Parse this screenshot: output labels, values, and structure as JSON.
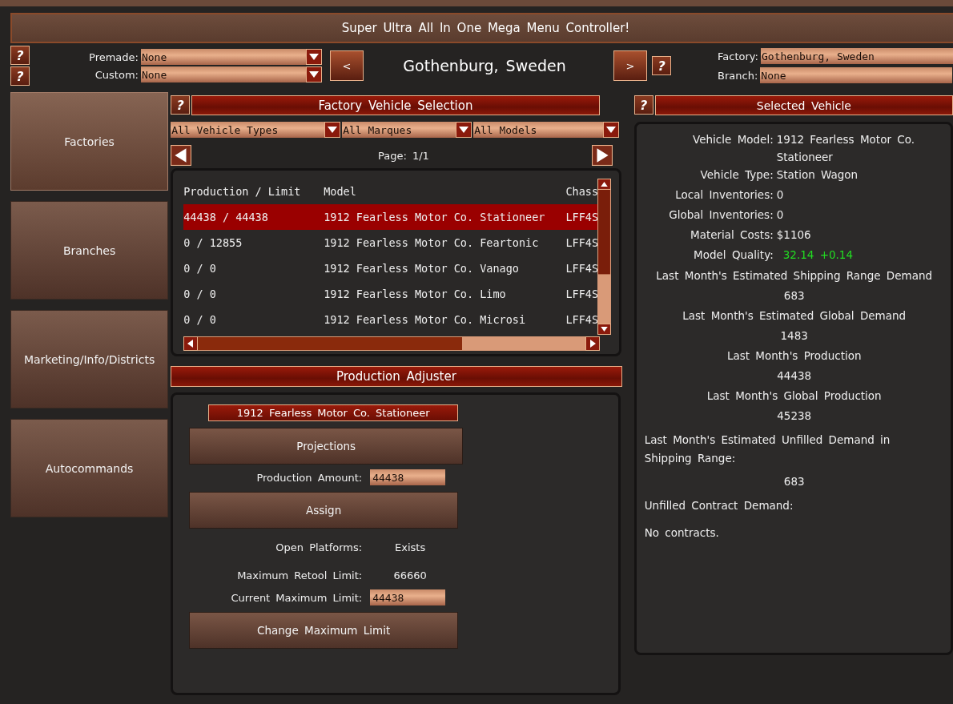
{
  "window": {
    "title": "Super Ultra All In One Mega Menu Controller!"
  },
  "top": {
    "left_help": [
      "?",
      "?"
    ],
    "selectors": [
      {
        "label": "Premade:",
        "value": "None"
      },
      {
        "label": "Custom:",
        "value": "None"
      }
    ],
    "prev_button": "<",
    "city": "Gothenburg, Sweden",
    "next_button": ">",
    "right_help": "?",
    "fields": [
      {
        "label": "Factory:",
        "value": "Gothenburg, Sweden"
      },
      {
        "label": "Branch:",
        "value": "None"
      }
    ]
  },
  "sidebar": {
    "items": [
      {
        "label": "Factories",
        "selected": true
      },
      {
        "label": "Branches",
        "selected": false
      },
      {
        "label": "Marketing/Info/Districts",
        "selected": false
      },
      {
        "label": "Autocommands",
        "selected": false
      }
    ]
  },
  "vehicle_selection": {
    "help": "?",
    "title": "Factory Vehicle Selection",
    "filters": [
      "All Vehicle Types",
      "All Marques",
      "All Models"
    ],
    "page": "Page: 1/1",
    "table": {
      "columns": [
        "Production / Limit",
        "Model",
        "Chass"
      ],
      "rows": [
        {
          "cells": [
            "44438 / 44438",
            "1912 Fearless Motor Co. Stationeer",
            "LFF4S"
          ],
          "selected": true
        },
        {
          "cells": [
            "0 / 12855",
            "1912 Fearless Motor Co. Feartonic",
            "LFF4S"
          ],
          "selected": false
        },
        {
          "cells": [
            "0 / 0",
            "1912 Fearless Motor Co. Vanago",
            "LFF4S"
          ],
          "selected": false
        },
        {
          "cells": [
            "0 / 0",
            "1912 Fearless Motor Co. Limo",
            "LFF4S"
          ],
          "selected": false
        },
        {
          "cells": [
            "0 / 0",
            "1912 Fearless Motor Co. Microsi",
            "LFF4S"
          ],
          "selected": false
        }
      ]
    }
  },
  "production_adjuster": {
    "title": "Production Adjuster",
    "model": "1912 Fearless Motor Co. Stationeer",
    "items": [
      {
        "kind": "button",
        "label": "Projections"
      },
      {
        "kind": "field",
        "label": "Production Amount:",
        "value": "44438"
      },
      {
        "kind": "button",
        "label": "Assign"
      },
      {
        "kind": "info",
        "label": "Open Platforms:",
        "value": "Exists"
      },
      {
        "kind": "info",
        "label": "Maximum Retool Limit:",
        "value": "66660"
      },
      {
        "kind": "field",
        "label": "Current Maximum Limit:",
        "value": "44438"
      },
      {
        "kind": "button",
        "label": "Change Maximum Limit"
      }
    ]
  },
  "selected_vehicle": {
    "help": "?",
    "title": "Selected Vehicle",
    "details": [
      {
        "kind": "pair",
        "label": "Vehicle Model:",
        "value": "1912 Fearless Motor Co. Stationeer",
        "highlight": false
      },
      {
        "kind": "pair",
        "label": "Vehicle Type:",
        "value": "Station Wagon",
        "highlight": false
      },
      {
        "kind": "pair",
        "label": "Local Inventories:",
        "value": "0",
        "highlight": false
      },
      {
        "kind": "pair",
        "label": "Global Inventories:",
        "value": "0",
        "highlight": false
      },
      {
        "kind": "pair",
        "label": "Material Costs:",
        "value": "$1106",
        "highlight": false
      },
      {
        "kind": "pair",
        "label": "Model Quality:",
        "value": "32.14 +0.14",
        "highlight": true
      },
      {
        "kind": "center",
        "text": "Last Month's Estimated Shipping Range Demand"
      },
      {
        "kind": "center",
        "text": "683"
      },
      {
        "kind": "center",
        "text": "Last Month's Estimated Global Demand"
      },
      {
        "kind": "center",
        "text": "1483"
      },
      {
        "kind": "center",
        "text": "Last Month's Production"
      },
      {
        "kind": "center",
        "text": "44438"
      },
      {
        "kind": "center",
        "text": "Last Month's Global Production"
      },
      {
        "kind": "center",
        "text": "45238"
      },
      {
        "kind": "left",
        "text": "Last Month's Estimated Unfilled Demand in Shipping Range:"
      },
      {
        "kind": "center",
        "text": "683"
      },
      {
        "kind": "left",
        "text": "Unfilled Contract Demand:"
      },
      {
        "kind": "left",
        "text": "No contracts."
      }
    ]
  }
}
